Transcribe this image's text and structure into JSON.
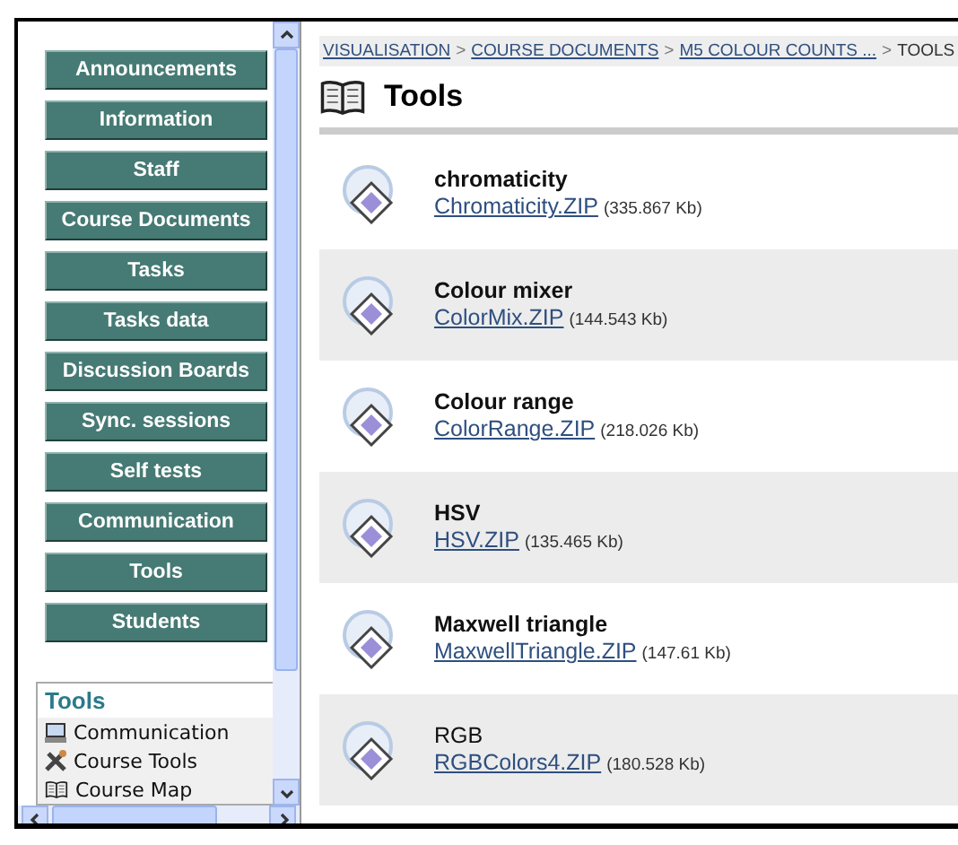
{
  "nav_buttons": [
    "Announcements",
    "Information",
    "Staff",
    "Course Documents",
    "Tasks",
    "Tasks data",
    "Discussion Boards",
    "Sync. sessions",
    "Self tests",
    "Communication",
    "Tools",
    "Students"
  ],
  "tools_box": {
    "title": "Tools",
    "items": [
      {
        "label": "Communication",
        "kind": "computer"
      },
      {
        "label": "Course Tools",
        "kind": "tools"
      },
      {
        "label": "Course Map",
        "kind": "book"
      }
    ]
  },
  "breadcrumb": [
    {
      "label": "VISUALISATION",
      "link": true
    },
    {
      "label": "COURSE DOCUMENTS",
      "link": true,
      "separator": ">"
    },
    {
      "label": "M5 COLOUR COUNTS ...",
      "link": true,
      "separator": ">"
    },
    {
      "label": "TOOLS",
      "link": false,
      "separator": ">"
    }
  ],
  "page_title": "Tools",
  "files": [
    {
      "title": "chromaticity",
      "bold": true,
      "file": "Chromaticity.ZIP",
      "size": "(335.867 Kb)"
    },
    {
      "title": "Colour mixer",
      "bold": true,
      "file": "ColorMix.ZIP",
      "size": "(144.543 Kb)"
    },
    {
      "title": "Colour range",
      "bold": true,
      "file": "ColorRange.ZIP",
      "size": "(218.026 Kb)"
    },
    {
      "title": "HSV",
      "bold": true,
      "file": "HSV.ZIP",
      "size": "(135.465 Kb)"
    },
    {
      "title": "Maxwell triangle",
      "bold": true,
      "file": "MaxwellTriangle.ZIP",
      "size": "(147.61 Kb)"
    },
    {
      "title": "RGB",
      "bold": false,
      "file": "RGBColors4.ZIP",
      "size": "(180.528 Kb)"
    }
  ]
}
